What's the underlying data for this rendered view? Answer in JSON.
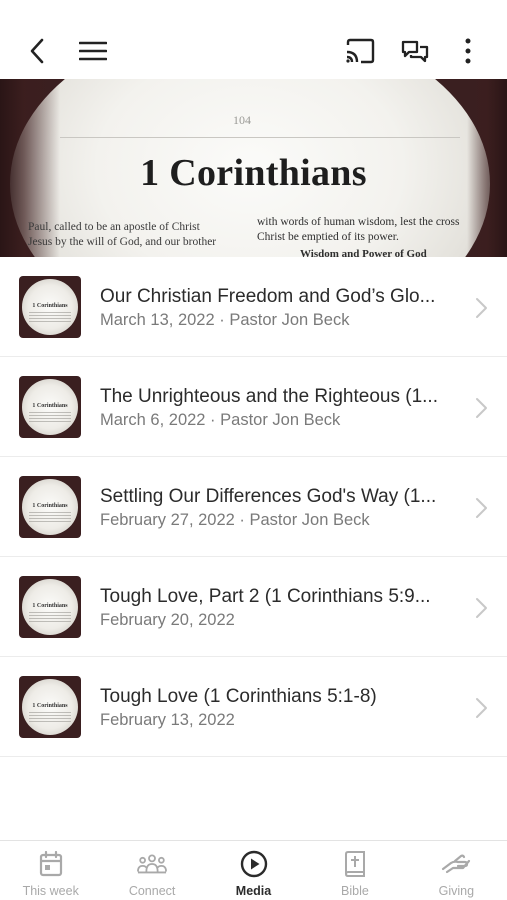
{
  "header": {
    "back_icon": "chevron-left-icon",
    "menu_icon": "hamburger-menu-icon",
    "cast_icon": "cast-icon",
    "chat_icon": "chat-bubbles-icon",
    "more_icon": "more-vertical-icon"
  },
  "hero": {
    "page_number": "104",
    "title": "1 Corinthians",
    "left_text_line1": "Paul, called to be an apostle of Christ",
    "left_text_line2": "Jesus by the will of God, and our brother",
    "right_text_line1": "with words of human wisdom, lest the cross",
    "right_text_line2": "Christ be emptied of its power.",
    "sub_heading": "Wisdom and Power of God"
  },
  "thumbnail": {
    "title": "1 Corinthians"
  },
  "sermons": [
    {
      "title": "Our Christian Freedom and God’s Glo...",
      "subtitle": "March 13, 2022 · Pastor Jon Beck"
    },
    {
      "title": "The Unrighteous and the Righteous (1...",
      "subtitle": "March 6, 2022 · Pastor Jon Beck"
    },
    {
      "title": "Settling Our Differences God's Way (1...",
      "subtitle": "February 27, 2022 · Pastor Jon Beck"
    },
    {
      "title": "Tough Love, Part 2 (1 Corinthians 5:9...",
      "subtitle": "February 20, 2022"
    },
    {
      "title": "Tough Love (1 Corinthians 5:1-8)",
      "subtitle": "February 13, 2022"
    }
  ],
  "tabs": [
    {
      "label": "This week",
      "icon": "calendar-icon",
      "active": false
    },
    {
      "label": "Connect",
      "icon": "people-group-icon",
      "active": false
    },
    {
      "label": "Media",
      "icon": "play-circle-icon",
      "active": true
    },
    {
      "label": "Bible",
      "icon": "bible-icon",
      "active": false
    },
    {
      "label": "Giving",
      "icon": "giving-hand-icon",
      "active": false
    }
  ],
  "colors": {
    "text_primary": "#2b2b2b",
    "text_secondary": "#7a7a7a",
    "tab_inactive": "#a9a9a9",
    "divider": "#ececec"
  }
}
